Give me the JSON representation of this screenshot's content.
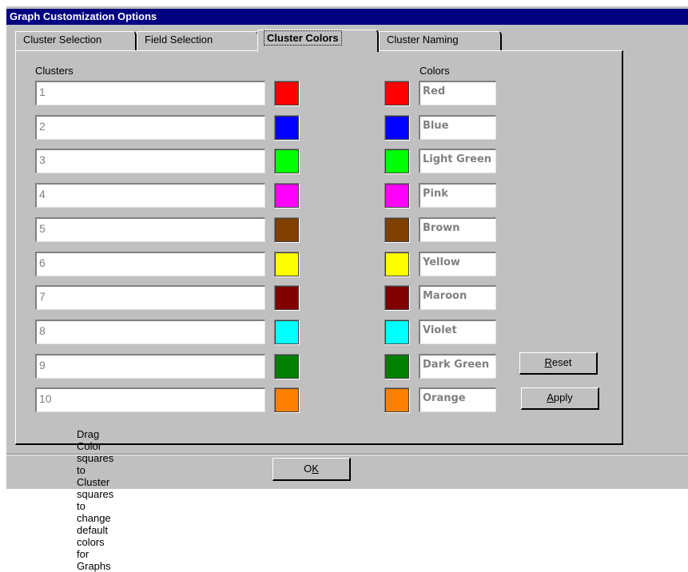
{
  "window": {
    "title": "Graph Customization Options"
  },
  "tabs": [
    {
      "label": "Cluster Selection",
      "active": false
    },
    {
      "label": "Field Selection",
      "active": false
    },
    {
      "label": "Cluster Colors",
      "active": true
    },
    {
      "label": "Cluster Naming",
      "active": false
    }
  ],
  "clusters_header": "Clusters",
  "colors_header": "Colors",
  "clusters": [
    {
      "value": "1",
      "color": "#ff0000"
    },
    {
      "value": "2",
      "color": "#0000ff"
    },
    {
      "value": "3",
      "color": "#00ff00"
    },
    {
      "value": "4",
      "color": "#ff00ff"
    },
    {
      "value": "5",
      "color": "#804000"
    },
    {
      "value": "6",
      "color": "#ffff00"
    },
    {
      "value": "7",
      "color": "#800000"
    },
    {
      "value": "8",
      "color": "#00ffff"
    },
    {
      "value": "9",
      "color": "#008000"
    },
    {
      "value": "10",
      "color": "#ff8000"
    }
  ],
  "colors": [
    {
      "name": "Red",
      "color": "#ff0000"
    },
    {
      "name": "Blue",
      "color": "#0000ff"
    },
    {
      "name": "Light Green",
      "color": "#00ff00"
    },
    {
      "name": "Pink",
      "color": "#ff00ff"
    },
    {
      "name": "Brown",
      "color": "#804000"
    },
    {
      "name": "Yellow",
      "color": "#ffff00"
    },
    {
      "name": "Maroon",
      "color": "#800000"
    },
    {
      "name": "Violet",
      "color": "#00ffff"
    },
    {
      "name": "Dark Green",
      "color": "#008000"
    },
    {
      "name": "Orange",
      "color": "#ff8000"
    }
  ],
  "buttons": {
    "reset": {
      "mnemonic": "R",
      "rest": "eset"
    },
    "apply": {
      "mnemonic": "A",
      "rest": "pply"
    },
    "ok": {
      "prefix": "O",
      "mnemonic": "K"
    }
  },
  "hint": "Drag Color squares to Cluster squares to change default colors for Graphs"
}
